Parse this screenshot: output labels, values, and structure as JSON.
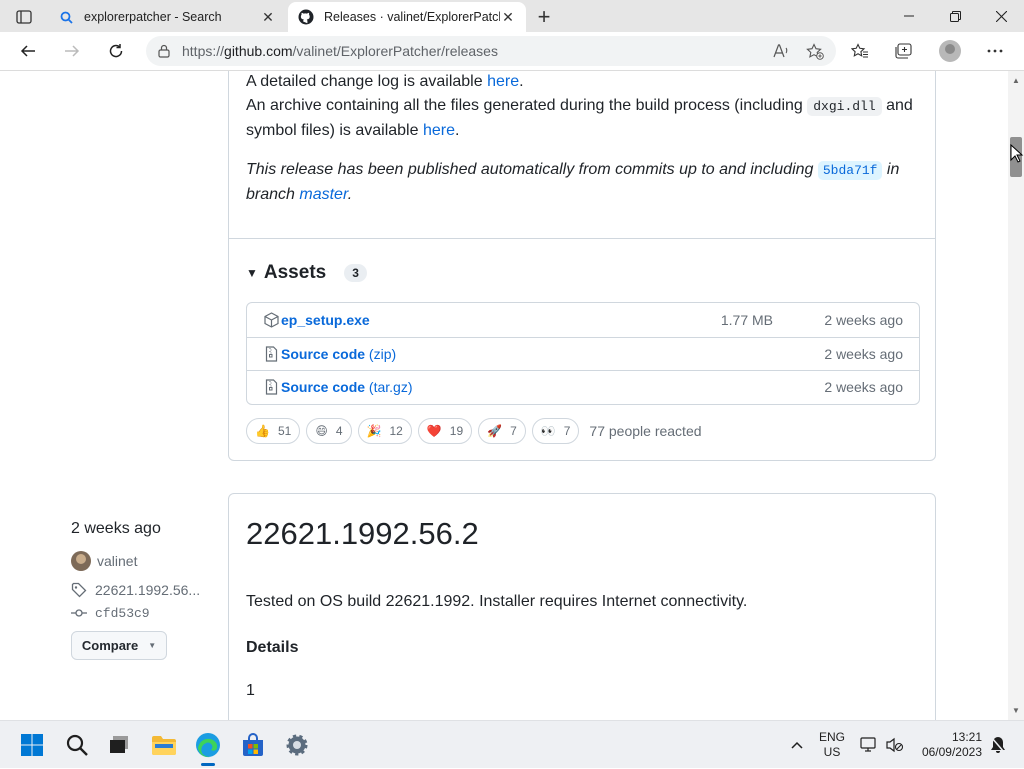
{
  "browser": {
    "tabs": [
      {
        "title": "explorerpatcher - Search",
        "active": false,
        "icon": "search-icon"
      },
      {
        "title": "Releases · valinet/ExplorerPatche",
        "active": true,
        "icon": "github-icon"
      }
    ],
    "url_prefix": "https://",
    "url_host": "github.com",
    "url_path": "/valinet/ExplorerPatcher/releases"
  },
  "release1": {
    "changelog_text": "A detailed change log is available ",
    "changelog_link": "here",
    "archive_text": "An archive containing all the files generated during the build process (including ",
    "archive_code": "dxgi.dll",
    "archive_text2": " and symbol files) is available ",
    "archive_link": "here",
    "published_text": "This release has been published automatically from commits up to and including ",
    "commit_sha": "5bda71f",
    "published_text2": " in branch ",
    "branch": "master",
    "assets_label": "Assets",
    "assets_count": "3",
    "assets": [
      {
        "name": "ep_setup.exe",
        "ext": "",
        "size": "1.77 MB",
        "date": "2 weeks ago",
        "icon": "package-icon"
      },
      {
        "name": "Source code",
        "ext": " (zip)",
        "size": "",
        "date": "2 weeks ago",
        "icon": "file-zip-icon"
      },
      {
        "name": "Source code",
        "ext": " (tar.gz)",
        "size": "",
        "date": "2 weeks ago",
        "icon": "file-zip-icon"
      }
    ],
    "reactions": [
      {
        "emoji": "👍",
        "count": "51"
      },
      {
        "emoji": "😄",
        "count": "4"
      },
      {
        "emoji": "🎉",
        "count": "12"
      },
      {
        "emoji": "❤️",
        "count": "19"
      },
      {
        "emoji": "🚀",
        "count": "7"
      },
      {
        "emoji": "👀",
        "count": "7"
      }
    ],
    "reactions_summary": "77 people reacted"
  },
  "release2": {
    "date": "2 weeks ago",
    "author": "valinet",
    "tag": "22621.1992.56...",
    "commit": "cfd53c9",
    "compare_label": "Compare",
    "title": "22621.1992.56.2",
    "description": "Tested on OS build 22621.1992. Installer requires Internet connectivity.",
    "details_label": "Details",
    "first_line": "1"
  },
  "taskbar": {
    "lang_top": "ENG",
    "lang_bottom": "US",
    "time": "13:21",
    "date": "06/09/2023"
  }
}
